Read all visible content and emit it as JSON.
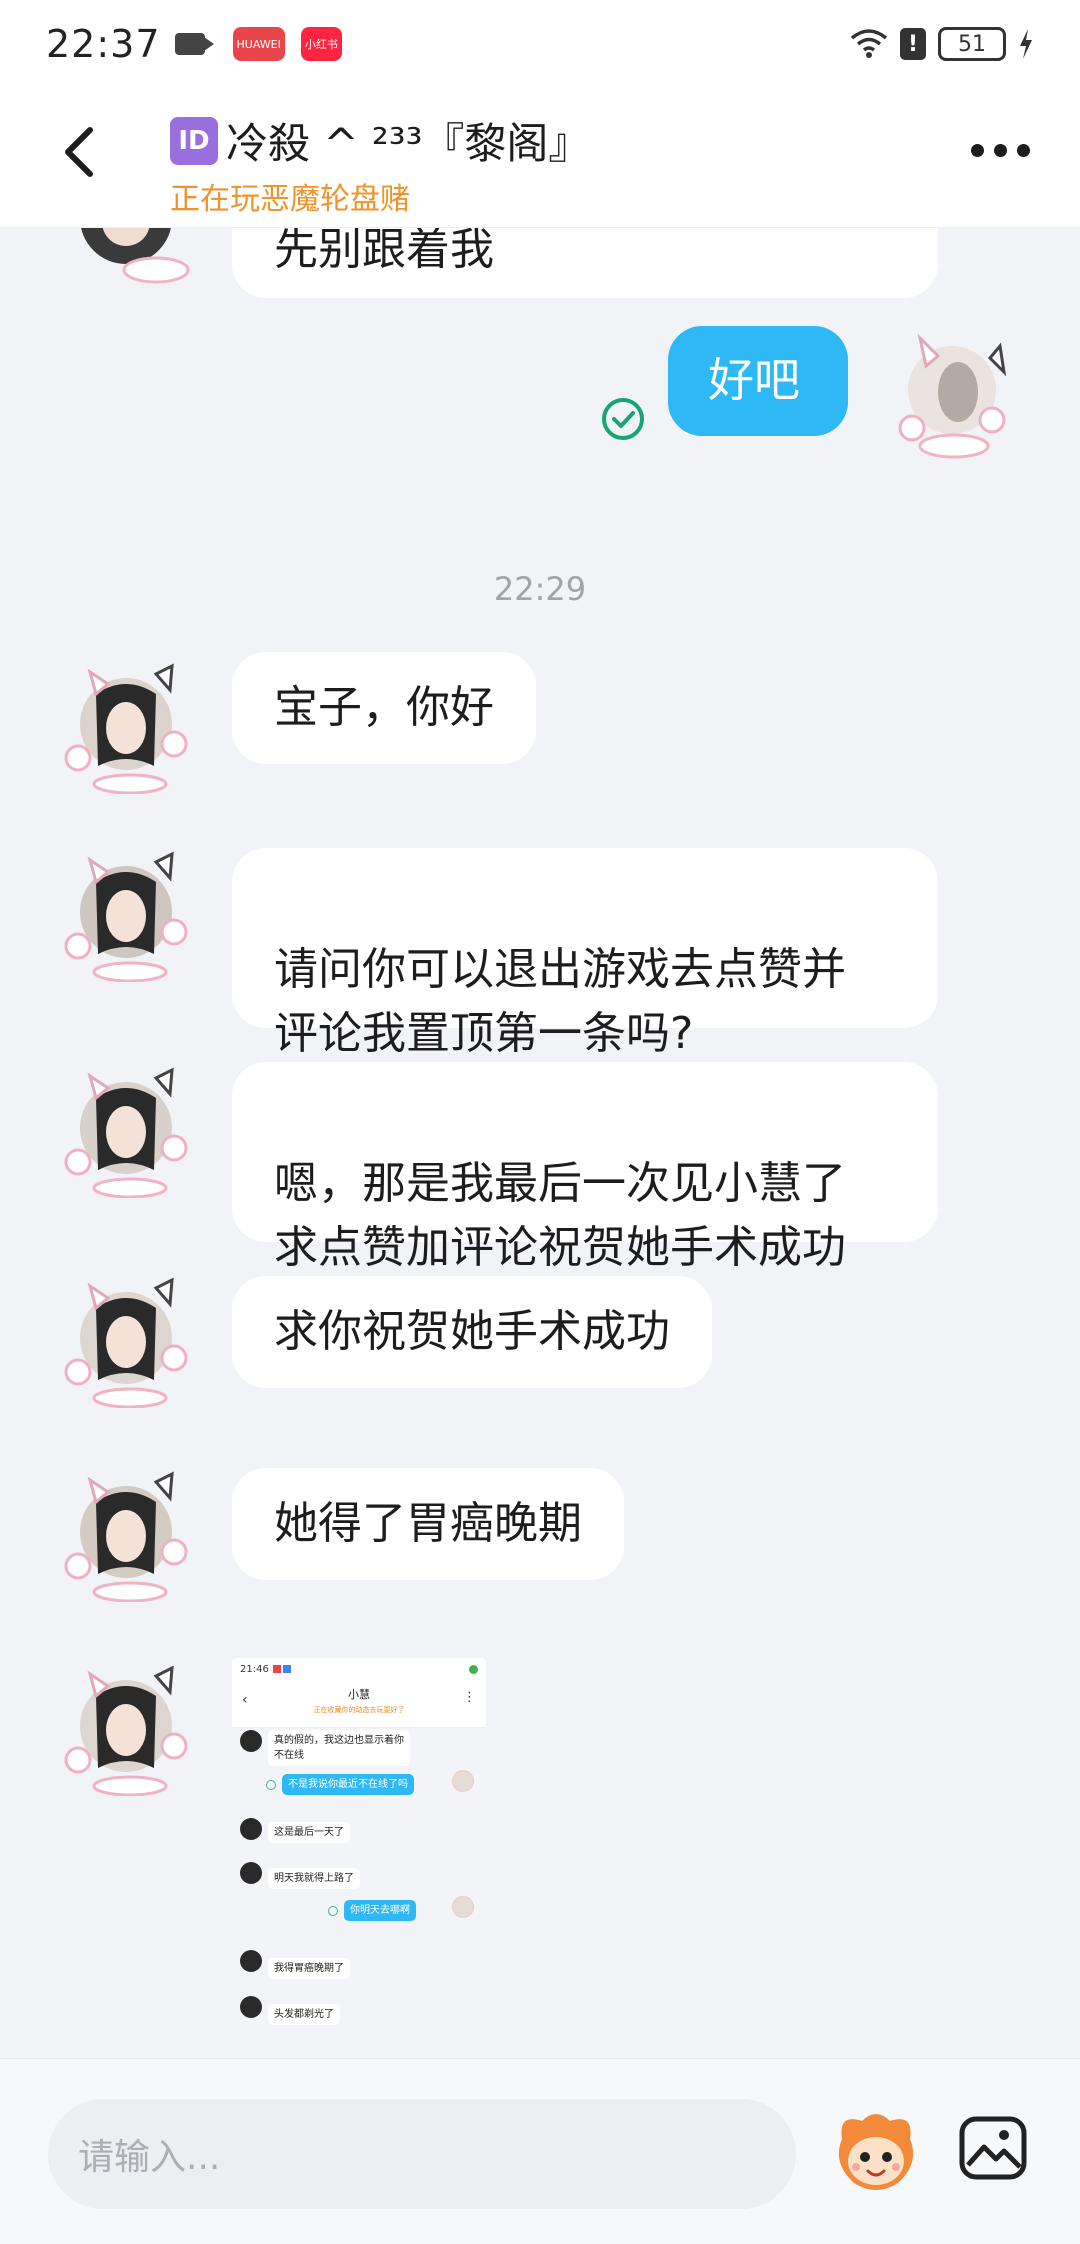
{
  "status": {
    "time": "22:37",
    "app1": "HUAWEI",
    "app2": "小红书",
    "battery": "51"
  },
  "header": {
    "id_badge": "ID",
    "title": "冷殺 ^ ²³³『黎阁』",
    "subtitle": "正在玩恶魔轮盘赌"
  },
  "chat": {
    "cut_message": "先别跟着我",
    "my_message": "好吧",
    "timestamp": "22:29",
    "messages": [
      "宝子，你好",
      "请问你可以退出游戏去点赞并\n评论我置顶第一条吗?",
      "嗯，那是我最后一次见小慧了\n求点赞加评论祝贺她手术成功",
      "求你祝贺她手术成功",
      "她得了胃癌晚期"
    ]
  },
  "screenshot": {
    "time": "21:46",
    "name": "小慧",
    "status": "正在收藏你的动态去玩耍好了",
    "msgs": [
      "真的假的，我这边也显示着你\n不在线",
      "不是我说你最近不在线了吗",
      "这是最后一天了",
      "明天我就得上路了",
      "你明天去哪啊",
      "我得胃癌晚期了",
      "头发都剃光了"
    ]
  },
  "input": {
    "placeholder": "请输入..."
  },
  "colors": {
    "accent_blue": "#2eb8f6",
    "subtitle_orange": "#f0932b",
    "check_green": "#17a673"
  },
  "icons": [
    "back-icon",
    "more-icon",
    "check-circle-icon",
    "mascot-icon",
    "image-icon"
  ]
}
